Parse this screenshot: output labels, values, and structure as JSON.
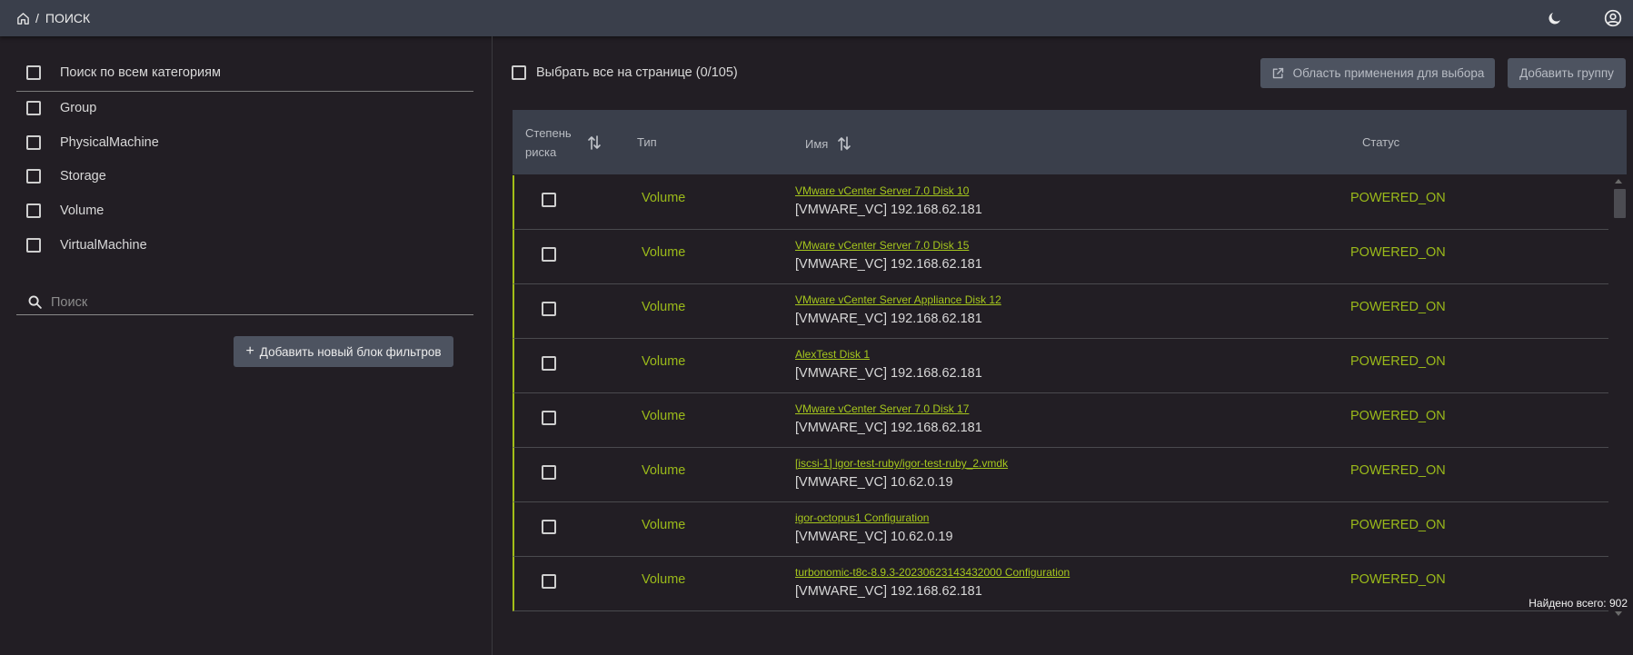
{
  "header": {
    "breadcrumb_separator": "/",
    "breadcrumb_current": "ПОИСК",
    "home_icon": "home-icon",
    "theme_icon": "moon-icon",
    "account_icon": "account-circle-icon"
  },
  "filters": {
    "all_categories_label": "Поиск по всем категориям",
    "categories": [
      {
        "label": "Group"
      },
      {
        "label": "PhysicalMachine"
      },
      {
        "label": "Storage"
      },
      {
        "label": "Volume"
      },
      {
        "label": "VirtualMachine"
      }
    ],
    "search_placeholder": "Поиск",
    "search_value": "",
    "add_filter_block_label": "Добавить новый блок фильтров"
  },
  "toolbar": {
    "select_all_label": "Выбрать все на странице (0/105)",
    "scope_button_label": "Область применения для выбора",
    "add_group_button_label": "Добавить группу"
  },
  "table": {
    "columns": {
      "risk": "Степень риска",
      "type": "Тип",
      "name": "Имя",
      "status": "Статус"
    },
    "rows": [
      {
        "type": "Volume",
        "name": "VMware vCenter Server 7.0 Disk 10",
        "source": "[VMWARE_VC] 192.168.62.181",
        "status": "POWERED_ON"
      },
      {
        "type": "Volume",
        "name": "VMware vCenter Server 7.0 Disk 15",
        "source": "[VMWARE_VC] 192.168.62.181",
        "status": "POWERED_ON"
      },
      {
        "type": "Volume",
        "name": "VMware vCenter Server Appliance Disk 12",
        "source": "[VMWARE_VC] 192.168.62.181",
        "status": "POWERED_ON"
      },
      {
        "type": "Volume",
        "name": "AlexTest Disk 1",
        "source": "[VMWARE_VC] 192.168.62.181",
        "status": "POWERED_ON"
      },
      {
        "type": "Volume",
        "name": "VMware vCenter Server 7.0 Disk 17",
        "source": "[VMWARE_VC] 192.168.62.181",
        "status": "POWERED_ON"
      },
      {
        "type": "Volume",
        "name": "[iscsi-1] igor-test-ruby/igor-test-ruby_2.vmdk",
        "source": "[VMWARE_VC] 10.62.0.19",
        "status": "POWERED_ON"
      },
      {
        "type": "Volume",
        "name": "igor-octopus1 Configuration",
        "source": "[VMWARE_VC] 10.62.0.19",
        "status": "POWERED_ON"
      },
      {
        "type": "Volume",
        "name": "turbonomic-t8c-8.9.3-20230623143432000 Configuration",
        "source": "[VMWARE_VC] 192.168.62.181",
        "status": "POWERED_ON"
      }
    ]
  },
  "footer": {
    "total_found": "Найдено всего: 902"
  },
  "colors": {
    "accent": "#9bba1a",
    "topbar": "#3a3f4b",
    "background": "#221e24",
    "button": "#4d5360"
  }
}
